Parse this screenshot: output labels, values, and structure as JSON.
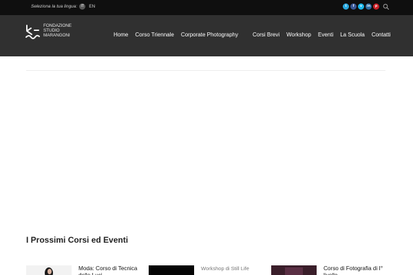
{
  "topbar": {
    "language_prompt": "Seleziona la tua lingua:",
    "lang_current": "IT",
    "lang_other": "EN",
    "socials": [
      {
        "name": "twitter-icon",
        "glyph": "t",
        "color": "#2aa9e0"
      },
      {
        "name": "facebook-icon",
        "glyph": "f",
        "color": "#3b5998"
      },
      {
        "name": "vimeo-icon",
        "glyph": "v",
        "color": "#1ab7ea"
      },
      {
        "name": "linkedin-icon",
        "glyph": "in",
        "color": "#2b6aa0"
      },
      {
        "name": "pinterest-icon",
        "glyph": "p",
        "color": "#cb2027"
      }
    ]
  },
  "logo": {
    "line1": "FONDAZIONE",
    "line2": "STUDIO",
    "line3": "MARANGONI"
  },
  "nav": {
    "items": [
      "Home",
      "Corso Triennale",
      "Corporate Photography",
      "Corsi Brevi",
      "Workshop",
      "Eventi",
      "La Scuola",
      "Contatti"
    ]
  },
  "main": {
    "section_title": "I Prossimi Corsi ed Eventi",
    "cards": [
      {
        "title": "Moda: Corso di Tecnica delle Luci",
        "thumb_color": "#f2f2f2"
      },
      {
        "title": "Workshop di Still Life",
        "thumb_color": "#050505"
      },
      {
        "title": "Corso di Fotografia di I° livello",
        "thumb_color": "#3a1e2a"
      }
    ]
  }
}
